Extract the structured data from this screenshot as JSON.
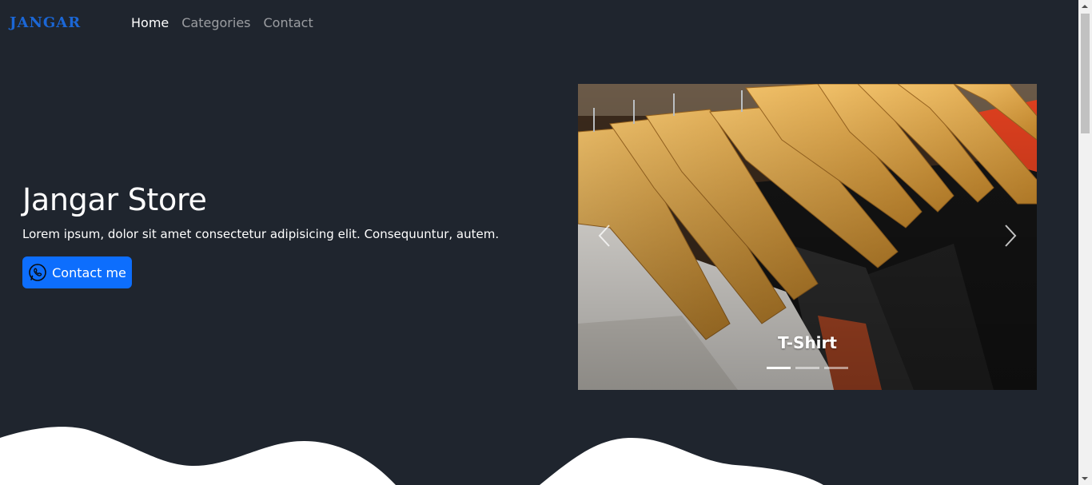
{
  "navbar": {
    "brand": "JANGAR",
    "links": [
      {
        "label": "Home",
        "active": true
      },
      {
        "label": "Categories",
        "active": false
      },
      {
        "label": "Contact",
        "active": false
      }
    ]
  },
  "hero": {
    "title": "Jangar Store",
    "text": "Lorem ipsum, dolor sit amet consectetur adipisicing elit. Consequuntur, autem.",
    "button_label": "Contact me",
    "button_icon": "whatsapp-icon"
  },
  "carousel": {
    "caption": "T-Shirt",
    "slide_count": 3,
    "active_slide": 1,
    "prev_icon": "chevron-left-icon",
    "next_icon": "chevron-right-icon"
  },
  "colors": {
    "background": "#1f252e",
    "brand": "#1b67d6",
    "primary_button": "#0d6efd",
    "wave": "#ffffff"
  }
}
